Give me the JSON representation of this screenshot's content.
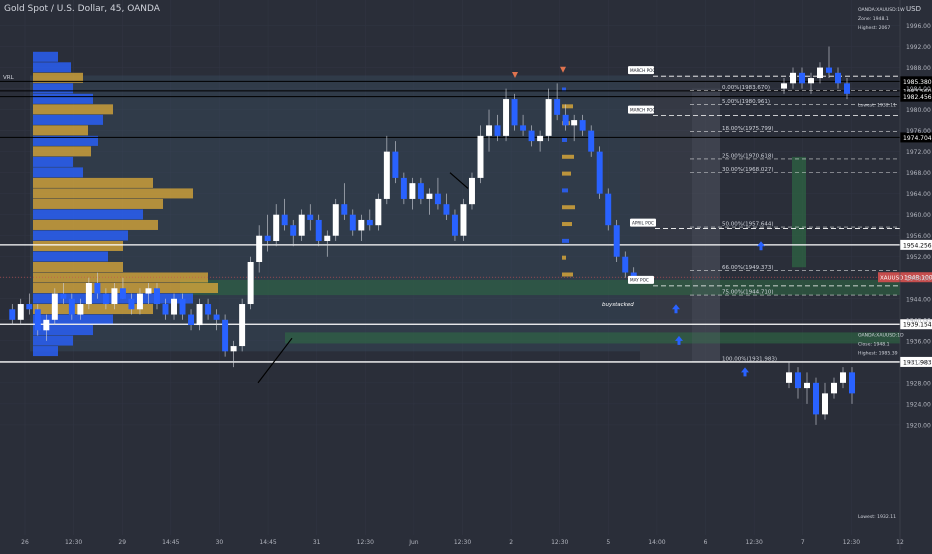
{
  "header": {
    "title": "Gold Spot / U.S. Dollar, 45, OANDA",
    "currency": "USD"
  },
  "chart_data": {
    "type": "candlestick",
    "symbol": "XAUUSD",
    "ylim": [
      1900,
      1998
    ],
    "y_ticks": [
      "1996.00",
      "1992.00",
      "1988.00",
      "1984.00",
      "1980.00",
      "1976.00",
      "1972.00",
      "1968.00",
      "1964.00",
      "1960.00",
      "1956.00",
      "1952.00",
      "1948.00",
      "1944.00",
      "1940.00",
      "1936.00",
      "1932.00",
      "1928.00",
      "1924.00",
      "1920.00"
    ],
    "x_labels": [
      "26",
      "12:30",
      "29",
      "14:45",
      "30",
      "14:45",
      "31",
      "12:30",
      "Jun",
      "12:30",
      "2",
      "12:30",
      "5",
      "14:00",
      "6",
      "12:30",
      "7",
      "12:30",
      "12"
    ],
    "price_levels": [
      {
        "label": "1985.380",
        "price": 1985.38,
        "style": "box"
      },
      {
        "label": "1983.560",
        "price": 1983.56,
        "style": "box"
      },
      {
        "label": "1982.456",
        "price": 1982.456,
        "style": "box"
      },
      {
        "label": "1974.704",
        "price": 1974.704,
        "style": "box"
      },
      {
        "label": "1954.256",
        "price": 1954.256,
        "style": "outline"
      },
      {
        "label": "1939.154",
        "price": 1939.154,
        "style": "outline"
      },
      {
        "label": "1931.983",
        "price": 1931.983,
        "style": "outline"
      },
      {
        "label": "XAUUSD",
        "price": 1948.1,
        "style": "current",
        "value": "1948.100"
      }
    ],
    "fib_levels": [
      {
        "label": "0.00%(1983.670)",
        "price": 1983.67
      },
      {
        "label": "5.00%(1980.961)",
        "price": 1980.961
      },
      {
        "label": "18.00%(1975.799)",
        "price": 1975.799
      },
      {
        "label": "25.00%(1970.618)",
        "price": 1970.618
      },
      {
        "label": "30.00%(1968.027)",
        "price": 1968.027
      },
      {
        "label": "50.00%(1957.644)",
        "price": 1957.644
      },
      {
        "label": "66.00%(1949.373)",
        "price": 1949.373
      },
      {
        "label": "75.00%(1944.710)",
        "price": 1944.71
      },
      {
        "label": "100.00%(1931.983)",
        "price": 1931.983
      }
    ],
    "poc_labels": [
      {
        "label": "MARCH POC",
        "price": 1987.5
      },
      {
        "label": "MARCH POC",
        "price": 1980.0
      },
      {
        "label": "APRIL POC",
        "price": 1958.5
      },
      {
        "label": "MAY POC",
        "price": 1947.6
      }
    ],
    "annotations": {
      "vrl": "VRL",
      "buy_stacked": "buystacked",
      "inset_top": [
        "OANDA:XAUUSD:1W",
        "Zone: 1948.1",
        "Highest: 2067"
      ],
      "inset_top_lowest": "Lowest: 1932.11",
      "inset_bottom": [
        "OANDA:XAUUSD:1D",
        "Close: 1948.1",
        "Highest: 1985.39"
      ],
      "inset_bottom_lowest": "Lowest: 1932.11"
    },
    "candles": [
      [
        1942,
        1943,
        1939,
        1940
      ],
      [
        1940,
        1944,
        1939,
        1943
      ],
      [
        1943,
        1945,
        1941,
        1942
      ],
      [
        1942,
        1943,
        1937,
        1938
      ],
      [
        1938,
        1941,
        1936,
        1940
      ],
      [
        1940,
        1946,
        1939,
        1945
      ],
      [
        1945,
        1947,
        1943,
        1944
      ],
      [
        1944,
        1945,
        1940,
        1941
      ],
      [
        1941,
        1944,
        1940,
        1943
      ],
      [
        1943,
        1948,
        1942,
        1947
      ],
      [
        1947,
        1949,
        1944,
        1945
      ],
      [
        1945,
        1946,
        1942,
        1943
      ],
      [
        1943,
        1947,
        1942,
        1946
      ],
      [
        1946,
        1948,
        1944,
        1944
      ],
      [
        1944,
        1945,
        1941,
        1942
      ],
      [
        1942,
        1946,
        1941,
        1945
      ],
      [
        1945,
        1947,
        1943,
        1946
      ],
      [
        1946,
        1947,
        1942,
        1943
      ],
      [
        1943,
        1944,
        1940,
        1941
      ],
      [
        1941,
        1945,
        1940,
        1944
      ],
      [
        1944,
        1945,
        1940,
        1941
      ],
      [
        1941,
        1942,
        1938,
        1939
      ],
      [
        1939,
        1944,
        1938,
        1943
      ],
      [
        1943,
        1944,
        1940,
        1941
      ],
      [
        1941,
        1942,
        1938,
        1940
      ],
      [
        1940,
        1941,
        1933,
        1934
      ],
      [
        1934,
        1936,
        1931,
        1935
      ],
      [
        1935,
        1944,
        1934,
        1943
      ],
      [
        1943,
        1952,
        1942,
        1951
      ],
      [
        1951,
        1958,
        1949,
        1956
      ],
      [
        1956,
        1960,
        1953,
        1955
      ],
      [
        1955,
        1962,
        1954,
        1960
      ],
      [
        1960,
        1963,
        1957,
        1958
      ],
      [
        1958,
        1959,
        1954,
        1956
      ],
      [
        1956,
        1961,
        1955,
        1960
      ],
      [
        1960,
        1962,
        1957,
        1959
      ],
      [
        1959,
        1960,
        1954,
        1955
      ],
      [
        1955,
        1957,
        1952,
        1956
      ],
      [
        1956,
        1963,
        1955,
        1962
      ],
      [
        1962,
        1966,
        1959,
        1960
      ],
      [
        1960,
        1961,
        1956,
        1957
      ],
      [
        1957,
        1960,
        1955,
        1959
      ],
      [
        1959,
        1961,
        1957,
        1958
      ],
      [
        1958,
        1964,
        1957,
        1963
      ],
      [
        1963,
        1975,
        1962,
        1972
      ],
      [
        1972,
        1974,
        1966,
        1967
      ],
      [
        1967,
        1968,
        1962,
        1963
      ],
      [
        1963,
        1967,
        1961,
        1966
      ],
      [
        1966,
        1967,
        1962,
        1963
      ],
      [
        1963,
        1965,
        1960,
        1964
      ],
      [
        1964,
        1967,
        1961,
        1962
      ],
      [
        1962,
        1964,
        1959,
        1960
      ],
      [
        1960,
        1961,
        1955,
        1956
      ],
      [
        1956,
        1963,
        1955,
        1962
      ],
      [
        1962,
        1968,
        1961,
        1967
      ],
      [
        1967,
        1977,
        1966,
        1975
      ],
      [
        1975,
        1980,
        1972,
        1977
      ],
      [
        1977,
        1979,
        1974,
        1975
      ],
      [
        1975,
        1984,
        1974,
        1982
      ],
      [
        1982,
        1983,
        1976,
        1977
      ],
      [
        1977,
        1979,
        1975,
        1976
      ],
      [
        1976,
        1977,
        1973,
        1974
      ],
      [
        1974,
        1976,
        1972,
        1975
      ],
      [
        1975,
        1984,
        1974,
        1982
      ],
      [
        1982,
        1985,
        1978,
        1979
      ],
      [
        1979,
        1981,
        1976,
        1977
      ],
      [
        1977,
        1979,
        1974,
        1978
      ],
      [
        1978,
        1979,
        1975,
        1976
      ],
      [
        1976,
        1977,
        1971,
        1972
      ],
      [
        1972,
        1973,
        1963,
        1964
      ],
      [
        1964,
        1965,
        1957,
        1958
      ],
      [
        1958,
        1959,
        1951,
        1952
      ],
      [
        1952,
        1953,
        1948,
        1949
      ],
      [
        1949,
        1950,
        1947,
        1948
      ]
    ],
    "inset_top_candles": [
      [
        1984,
        1986,
        1983,
        1985
      ],
      [
        1985,
        1988,
        1984,
        1987
      ],
      [
        1987,
        1988,
        1984,
        1985
      ],
      [
        1985,
        1987,
        1983,
        1986
      ],
      [
        1986,
        1989,
        1985,
        1988
      ],
      [
        1988,
        1992,
        1986,
        1987
      ],
      [
        1987,
        1988,
        1984,
        1985
      ],
      [
        1985,
        1986,
        1982,
        1983
      ]
    ],
    "inset_bottom_candles": [
      [
        1928,
        1932,
        1927,
        1930
      ],
      [
        1930,
        1931,
        1925,
        1927
      ],
      [
        1927,
        1930,
        1924,
        1928
      ],
      [
        1928,
        1929,
        1920,
        1922
      ],
      [
        1922,
        1928,
        1921,
        1926
      ],
      [
        1926,
        1929,
        1925,
        1928
      ],
      [
        1928,
        1931,
        1927,
        1930
      ],
      [
        1930,
        1931,
        1924,
        1926
      ]
    ]
  }
}
